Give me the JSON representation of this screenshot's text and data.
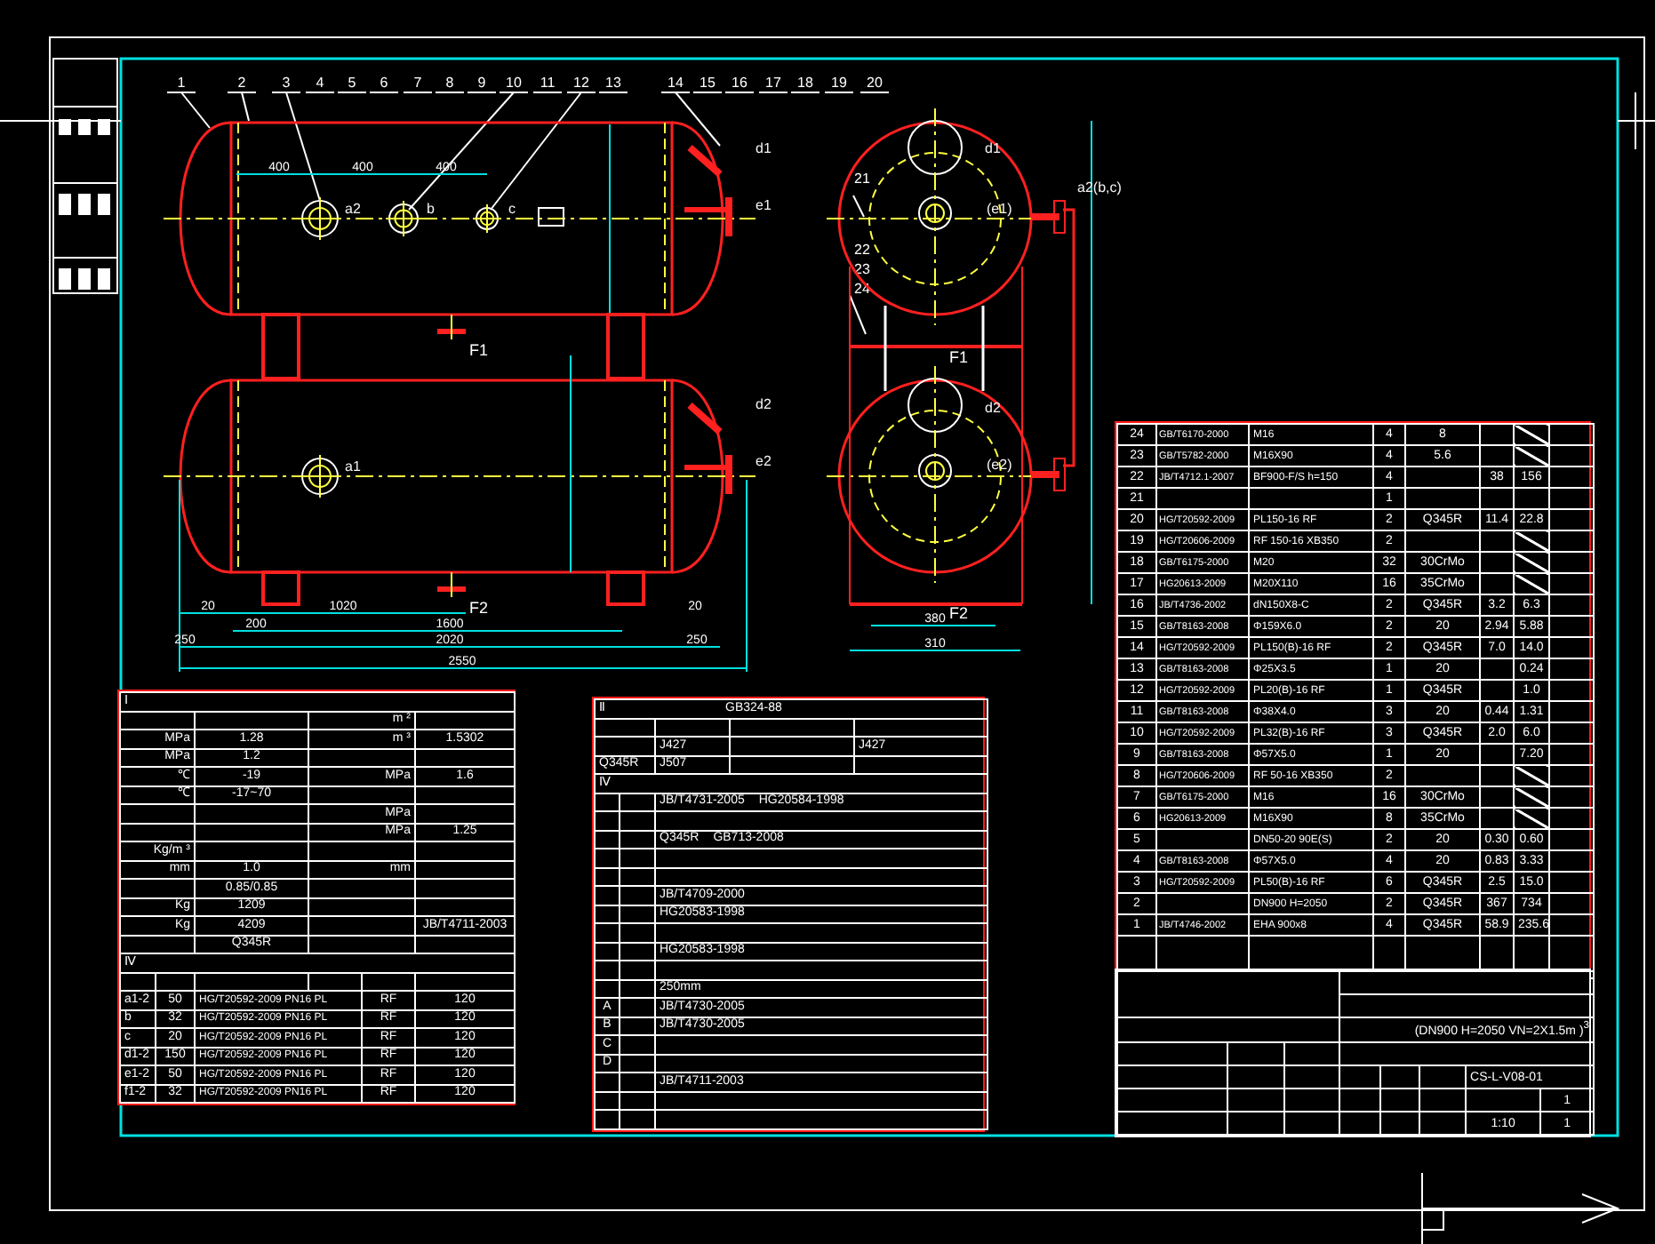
{
  "drawing": {
    "balloons": [
      "1",
      "2",
      "3",
      "4",
      "5",
      "6",
      "7",
      "8",
      "9",
      "10",
      "11",
      "12",
      "13",
      "14",
      "15",
      "16",
      "17",
      "18",
      "19",
      "20"
    ],
    "side_balloons": [
      "21",
      "22",
      "23",
      "24"
    ],
    "front_labels": [
      {
        "kind": "nozzle",
        "text": "a2"
      },
      {
        "kind": "nozzle",
        "text": "b"
      },
      {
        "kind": "nozzle",
        "text": "c"
      },
      {
        "kind": "nozzle",
        "text": "d1"
      },
      {
        "kind": "nozzle",
        "text": "e1"
      },
      {
        "kind": "support",
        "text": "F1"
      },
      {
        "kind": "nozzle",
        "text": "a1"
      },
      {
        "kind": "nozzle",
        "text": "d2"
      },
      {
        "kind": "nozzle",
        "text": "e2"
      },
      {
        "kind": "support",
        "text": "F2"
      }
    ],
    "top_dims": [
      "400",
      "400",
      "400"
    ],
    "bottom_dims": [
      "20",
      "1020",
      "20",
      "200",
      "1600",
      "250",
      "2020",
      "250",
      "2550"
    ],
    "side_labels": [
      {
        "kind": "nozzle",
        "text": "d1"
      },
      {
        "kind": "nozzle",
        "text": "(e1)"
      },
      {
        "kind": "nozzle",
        "text": "a2(b,c)"
      },
      {
        "kind": "support",
        "text": "F1"
      },
      {
        "kind": "nozzle",
        "text": "d2"
      },
      {
        "kind": "nozzle",
        "text": "(e2)"
      },
      {
        "kind": "support",
        "text": "F2"
      }
    ],
    "side_dims": [
      "380",
      "310"
    ]
  },
  "design_table": {
    "section": "Ⅰ",
    "rows": [
      {
        "right_unit": "m ²"
      },
      {
        "unit": "MPa",
        "value": "1.28",
        "right_unit": "m ³",
        "right_value": "1.5302"
      },
      {
        "unit": "MPa",
        "value": "1.2"
      },
      {
        "unit": "℃",
        "value": "-19",
        "right_unit": "MPa",
        "right_value": "1.6"
      },
      {
        "unit": "℃",
        "value": "-17~70"
      },
      {
        "right_unit": "MPa"
      },
      {
        "right_unit": "MPa",
        "right_value": "1.25"
      },
      {
        "unit": "Kg/m ³"
      },
      {
        "unit": "mm",
        "value": "1.0",
        "right_unit": "mm"
      },
      {
        "value": "0.85/0.85"
      },
      {
        "unit": "Kg",
        "value": "1209"
      },
      {
        "unit": "Kg",
        "value": "4209",
        "right_value": "JB/T4711-2003"
      },
      {
        "value": "Q345R"
      }
    ],
    "nozzle_section": "Ⅳ",
    "nozzles": [
      {
        "mark": "a1-2",
        "dn": "50",
        "standard": "HG/T20592-2009 PN16 PL",
        "face": "RF",
        "length": "120"
      },
      {
        "mark": "b",
        "dn": "32",
        "standard": "HG/T20592-2009 PN16 PL",
        "face": "RF",
        "length": "120"
      },
      {
        "mark": "c",
        "dn": "20",
        "standard": "HG/T20592-2009 PN16 PL",
        "face": "RF",
        "length": "120"
      },
      {
        "mark": "d1-2",
        "dn": "150",
        "standard": "HG/T20592-2009 PN16 PL",
        "face": "RF",
        "length": "120"
      },
      {
        "mark": "e1-2",
        "dn": "50",
        "standard": "HG/T20592-2009 PN16 PL",
        "face": "RF",
        "length": "120"
      },
      {
        "mark": "f1-2",
        "dn": "32",
        "standard": "HG/T20592-2009 PN16 PL",
        "face": "RF",
        "length": "120"
      }
    ]
  },
  "spec_table": {
    "section": "Ⅱ",
    "standard": "GB324-88",
    "weld_rows": [
      {},
      {
        "col_2": "J427",
        "col_4": "J427"
      },
      {
        "col_1": "Q345R",
        "col_2": "J507"
      }
    ],
    "spec_section": "Ⅳ",
    "spec_rows": [
      {
        "texts": [
          "JB/T4731-2005",
          "HG20584-1998"
        ]
      },
      {
        "texts": []
      },
      {
        "texts": [
          "Q345R",
          "GB713-2008"
        ]
      },
      {
        "texts": []
      },
      {
        "texts": []
      },
      {
        "texts": [
          "JB/T4709-2000"
        ]
      },
      {
        "texts": [
          "HG20583-1998"
        ]
      },
      {
        "texts": []
      },
      {
        "texts": [
          "HG20583-1998"
        ]
      },
      {
        "texts": []
      },
      {
        "texts": [
          "250mm"
        ]
      },
      {
        "texts": [
          "JB/T4730-2005"
        ]
      },
      {
        "texts": [
          "JB/T4730-2005"
        ]
      },
      {
        "texts": []
      },
      {
        "texts": []
      },
      {
        "texts": [
          "JB/T4711-2003"
        ]
      },
      {
        "texts": []
      },
      {
        "texts": []
      }
    ],
    "inspection_marks": [
      "A",
      "B",
      "C",
      "D"
    ]
  },
  "parts": [
    {
      "no": "24",
      "standard": "GB/T6170-2000",
      "name": "M16",
      "qty": "4",
      "material": "8",
      "slash": true
    },
    {
      "no": "23",
      "standard": "GB/T5782-2000",
      "name": "M16X90",
      "qty": "4",
      "material": "5.6",
      "slash": true
    },
    {
      "no": "22",
      "standard": "JB/T4712.1-2007",
      "name": "BF900-F/S h=150",
      "qty": "4",
      "unit_weight": "38",
      "total_weight": "156",
      "slash": false
    },
    {
      "no": "21",
      "qty": "1",
      "slash": false
    },
    {
      "no": "20",
      "standard": "HG/T20592-2009",
      "name": "PL150-16 RF",
      "qty": "2",
      "material": "Q345R",
      "unit_weight": "11.4",
      "total_weight": "22.8",
      "slash": false
    },
    {
      "no": "19",
      "standard": "HG/T20606-2009",
      "name": "RF 150-16 XB350",
      "qty": "2",
      "slash": true
    },
    {
      "no": "18",
      "standard": "GB/T6175-2000",
      "name": "M20",
      "qty": "32",
      "material": "30CrMo",
      "slash": true
    },
    {
      "no": "17",
      "standard": "HG20613-2009",
      "name": "M20X110",
      "qty": "16",
      "material": "35CrMo",
      "slash": true
    },
    {
      "no": "16",
      "standard": "JB/T4736-2002",
      "name": "dN150X8-C",
      "qty": "2",
      "material": "Q345R",
      "unit_weight": "3.2",
      "total_weight": "6.3",
      "slash": false
    },
    {
      "no": "15",
      "standard": "GB/T8163-2008",
      "name": "Φ159X6.0",
      "qty": "2",
      "material": "20",
      "unit_weight": "2.94",
      "total_weight": "5.88",
      "slash": false
    },
    {
      "no": "14",
      "standard": "HG/T20592-2009",
      "name": "PL150(B)-16 RF",
      "qty": "2",
      "material": "Q345R",
      "unit_weight": "7.0",
      "total_weight": "14.0",
      "slash": false
    },
    {
      "no": "13",
      "standard": "GB/T8163-2008",
      "name": "Φ25X3.5",
      "qty": "1",
      "material": "20",
      "total_weight": "0.24",
      "slash": false
    },
    {
      "no": "12",
      "standard": "HG/T20592-2009",
      "name": "PL20(B)-16 RF",
      "qty": "1",
      "material": "Q345R",
      "total_weight": "1.0",
      "slash": false
    },
    {
      "no": "11",
      "standard": "GB/T8163-2008",
      "name": "Φ38X4.0",
      "qty": "3",
      "material": "20",
      "unit_weight": "0.44",
      "total_weight": "1.31",
      "slash": false
    },
    {
      "no": "10",
      "standard": "HG/T20592-2009",
      "name": "PL32(B)-16 RF",
      "qty": "3",
      "material": "Q345R",
      "unit_weight": "2.0",
      "total_weight": "6.0",
      "slash": false
    },
    {
      "no": "9",
      "standard": "GB/T8163-2008",
      "name": "Φ57X5.0",
      "qty": "1",
      "material": "20",
      "total_weight": "7.20",
      "slash": false
    },
    {
      "no": "8",
      "standard": "HG/T20606-2009",
      "name": "RF 50-16 XB350",
      "qty": "2",
      "slash": true
    },
    {
      "no": "7",
      "standard": "GB/T6175-2000",
      "name": "M16",
      "qty": "16",
      "material": "30CrMo",
      "slash": true
    },
    {
      "no": "6",
      "standard": "HG20613-2009",
      "name": "M16X90",
      "qty": "8",
      "material": "35CrMo",
      "slash": true
    },
    {
      "no": "5",
      "name": "DN50-20 90E(S)",
      "qty": "2",
      "material": "20",
      "unit_weight": "0.30",
      "total_weight": "0.60",
      "slash": false
    },
    {
      "no": "4",
      "standard": "GB/T8163-2008",
      "name": "Φ57X5.0",
      "qty": "4",
      "material": "20",
      "unit_weight": "0.83",
      "total_weight": "3.33",
      "slash": false
    },
    {
      "no": "3",
      "standard": "HG/T20592-2009",
      "name": "PL50(B)-16 RF",
      "qty": "6",
      "material": "Q345R",
      "unit_weight": "2.5",
      "total_weight": "15.0",
      "slash": false
    },
    {
      "no": "2",
      "name": "DN900 H=2050",
      "qty": "2",
      "material": "Q345R",
      "unit_weight": "367",
      "total_weight": "734",
      "slash": false
    },
    {
      "no": "1",
      "standard": "JB/T4746-2002",
      "name": "EHA 900x8",
      "qty": "4",
      "material": "Q345R",
      "unit_weight": "58.9",
      "total_weight": "235.6",
      "slash": false
    }
  ],
  "title_block": {
    "title": "(DN900 H=2050 VN=2X1.5m )$^{3}$",
    "drawing_no": "CS-L-V08-01",
    "scale": "1:10",
    "sheet_total": "1",
    "sheet_no": "1"
  }
}
